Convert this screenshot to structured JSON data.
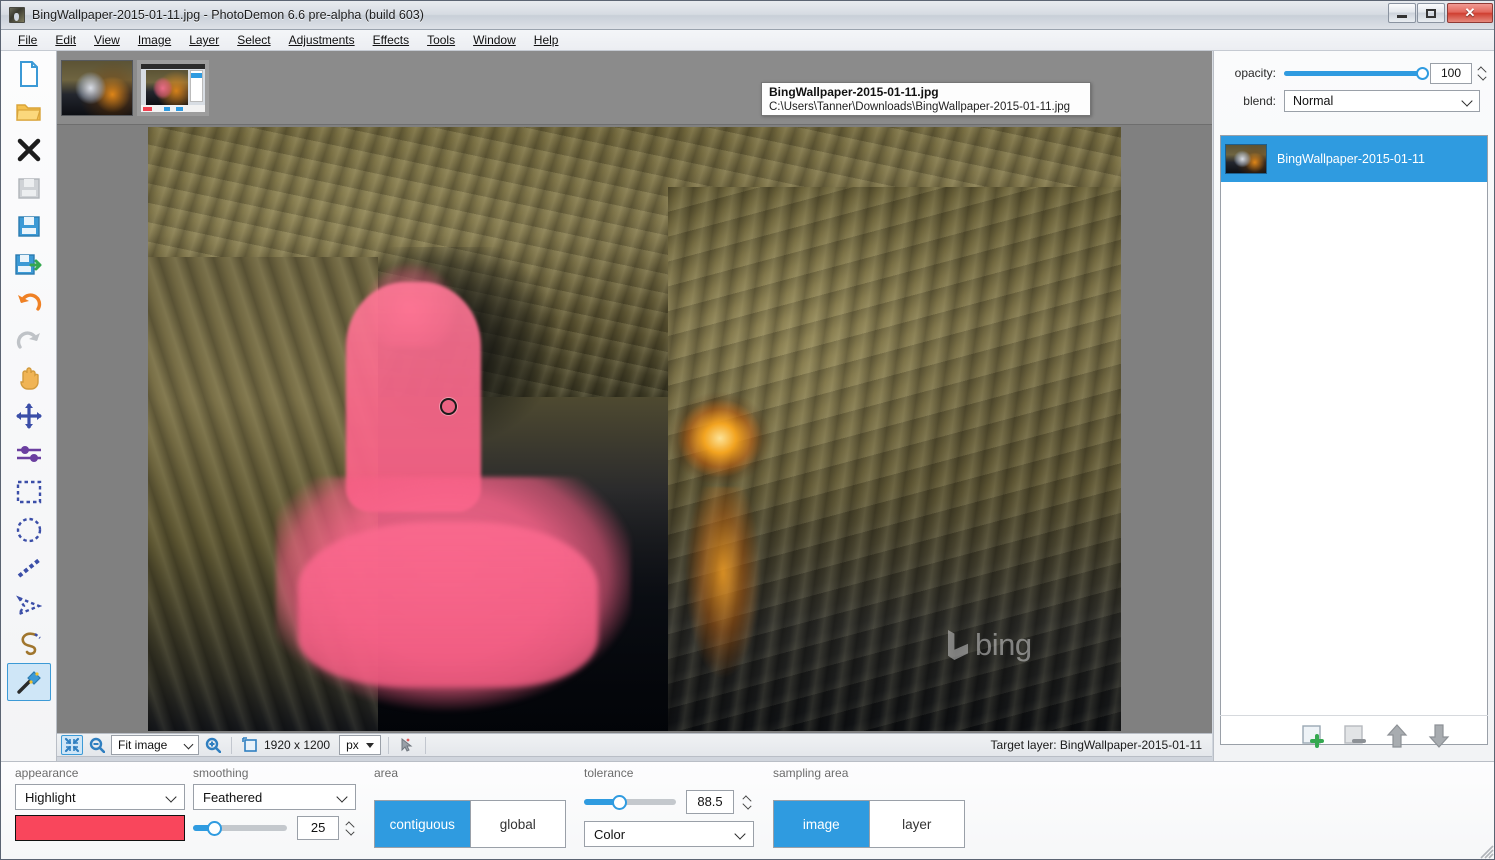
{
  "window": {
    "title": "BingWallpaper-2015-01-11.jpg  -  PhotoDemon 6.6 pre-alpha (build 603)",
    "app_icon": "image-file-icon",
    "minimize_label": "Minimize",
    "maximize_label": "Restore",
    "close_label": "Close"
  },
  "menubar": {
    "items": [
      {
        "label": "File"
      },
      {
        "label": "Edit"
      },
      {
        "label": "View"
      },
      {
        "label": "Image"
      },
      {
        "label": "Layer"
      },
      {
        "label": "Select"
      },
      {
        "label": "Adjustments"
      },
      {
        "label": "Effects"
      },
      {
        "label": "Tools"
      },
      {
        "label": "Window"
      },
      {
        "label": "Help"
      }
    ]
  },
  "toolbar": {
    "tools": [
      {
        "name": "new-image",
        "title": "New image"
      },
      {
        "name": "open-image",
        "title": "Open image"
      },
      {
        "name": "close-image",
        "title": "Close image"
      },
      {
        "name": "save-image",
        "title": "Save"
      },
      {
        "name": "save-as-image",
        "title": "Save as"
      },
      {
        "name": "save-copy-image",
        "title": "Save copy"
      },
      {
        "name": "undo",
        "title": "Undo"
      },
      {
        "name": "redo",
        "title": "Redo"
      },
      {
        "name": "pan-hand",
        "title": "Pan"
      },
      {
        "name": "move-layer",
        "title": "Move / size"
      },
      {
        "name": "adjust-sliders",
        "title": "Adjustments"
      },
      {
        "name": "select-rectangle",
        "title": "Rectangular selection"
      },
      {
        "name": "select-ellipse",
        "title": "Elliptical selection"
      },
      {
        "name": "select-line",
        "title": "Line selection"
      },
      {
        "name": "select-polygon",
        "title": "Polygon selection"
      },
      {
        "name": "select-lasso",
        "title": "Lasso selection"
      },
      {
        "name": "magic-wand",
        "title": "Magic wand selection"
      }
    ],
    "selected_tool": "magic-wand"
  },
  "thumbnails": [
    {
      "name": "thumbnail-cave",
      "active": false
    },
    {
      "name": "thumbnail-screenshot",
      "active": true
    }
  ],
  "tooltip": {
    "title": "BingWallpaper-2015-01-11.jpg",
    "path": "C:\\Users\\Tanner\\Downloads\\BingWallpaper-2015-01-11.jpg"
  },
  "canvas": {
    "watermark": "bing",
    "cursor_marker": "magic-wand-cursor-ring"
  },
  "statusbar": {
    "fit_icon": "fit-to-screen-icon",
    "zoom_out_icon": "zoom-out-icon",
    "zoom_value": "Fit image",
    "zoom_in_icon": "zoom-in-icon",
    "size_icon": "image-size-icon",
    "image_size": "1920 x 1200",
    "unit": "px",
    "cursor_icon": "cursor-position-icon",
    "target_layer": "Target layer: BingWallpaper-2015-01-11"
  },
  "rightpanel": {
    "opacity_label": "opacity:",
    "opacity_value": "100",
    "blend_label": "blend:",
    "blend_value": "Normal",
    "layers": [
      {
        "name": "BingWallpaper-2015-01-11",
        "selected": true
      }
    ],
    "buttons": [
      {
        "name": "add-layer-button",
        "label": "Add layer"
      },
      {
        "name": "delete-layer-button",
        "label": "Delete layer"
      },
      {
        "name": "move-layer-up-button",
        "label": "Move layer up"
      },
      {
        "name": "move-layer-down-button",
        "label": "Move layer down"
      }
    ]
  },
  "options": {
    "appearance": {
      "title": "appearance",
      "value": "Highlight",
      "swatch_color": "#f9465c"
    },
    "smoothing": {
      "title": "smoothing",
      "value": "Feathered",
      "amount": "25",
      "amount_percent": 22
    },
    "area": {
      "title": "area",
      "options": [
        "contiguous",
        "global"
      ],
      "selected": "contiguous"
    },
    "tolerance": {
      "title": "tolerance",
      "value": "88.5",
      "percent": 38,
      "compare_mode": "Color"
    },
    "sampling_area": {
      "title": "sampling area",
      "options": [
        "image",
        "layer"
      ],
      "selected": "image"
    }
  },
  "colors": {
    "accent": "#2f9be0",
    "highlight_red": "#f9465c",
    "canvas_bg": "#808080",
    "panel_bg": "#f6f7f8"
  }
}
